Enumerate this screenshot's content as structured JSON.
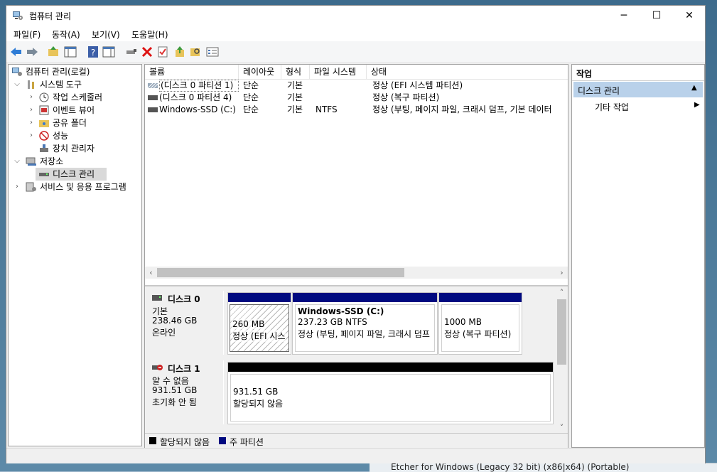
{
  "window": {
    "title": "컴퓨터 관리",
    "minimize": "─",
    "maximize": "☐",
    "close": "✕"
  },
  "menu": [
    "파일(F)",
    "동작(A)",
    "보기(V)",
    "도움말(H)"
  ],
  "tree": {
    "root": "컴퓨터 관리(로컬)",
    "system_tools": "시스템 도구",
    "task_scheduler": "작업 스케줄러",
    "event_viewer": "이벤트 뷰어",
    "shared_folders": "공유 폴더",
    "performance": "성능",
    "device_manager": "장치 관리자",
    "storage": "저장소",
    "disk_management": "디스크 관리",
    "services_apps": "서비스 및 응용 프로그램"
  },
  "volumes": {
    "headers": [
      "볼륨",
      "레이아웃",
      "형식",
      "파일 시스템",
      "상태"
    ],
    "rows": [
      {
        "name": "(디스크 0 파티션 1)",
        "layout": "단순",
        "type": "기본",
        "fs": "",
        "status": "정상 (EFI 시스템 파티션)"
      },
      {
        "name": "(디스크 0 파티션 4)",
        "layout": "단순",
        "type": "기본",
        "fs": "",
        "status": "정상 (복구 파티션)"
      },
      {
        "name": "Windows-SSD (C:)",
        "layout": "단순",
        "type": "기본",
        "fs": "NTFS",
        "status": "정상 (부팅, 페이지 파일, 크래시 덤프, 기본 데이터"
      }
    ]
  },
  "disks": [
    {
      "name": "디스크 0",
      "kind": "기본",
      "size": "238.46 GB",
      "state": "온라인",
      "partitions": [
        {
          "title": "",
          "size": "260 MB",
          "status": "정상 (EFI 시스"
        },
        {
          "title": "Windows-SSD  (C:)",
          "size": "237.23 GB NTFS",
          "status": "정상 (부팅, 페이지 파일, 크래시 덤프"
        },
        {
          "title": "",
          "size": "1000 MB",
          "status": "정상 (복구 파티션)"
        }
      ]
    },
    {
      "name": "디스크 1",
      "kind": "알 수 없음",
      "size": "931.51 GB",
      "state": "초기화 안 됨",
      "partitions": [
        {
          "title": "",
          "size": "931.51 GB",
          "status": "할당되지 않음"
        }
      ]
    }
  ],
  "legend": {
    "unallocated": "할당되지 않음",
    "primary": "주 파티션"
  },
  "actions": {
    "header": "작업",
    "section": "디스크 관리",
    "more": "기타 작업"
  },
  "colors": {
    "primary_partition": "#000a80",
    "unallocated": "#000000",
    "action_section_bg": "#b9d1ea"
  },
  "background_taskbar_text": "Etcher for Windows (Legacy 32 bit) (x86|x64) (Portable)"
}
